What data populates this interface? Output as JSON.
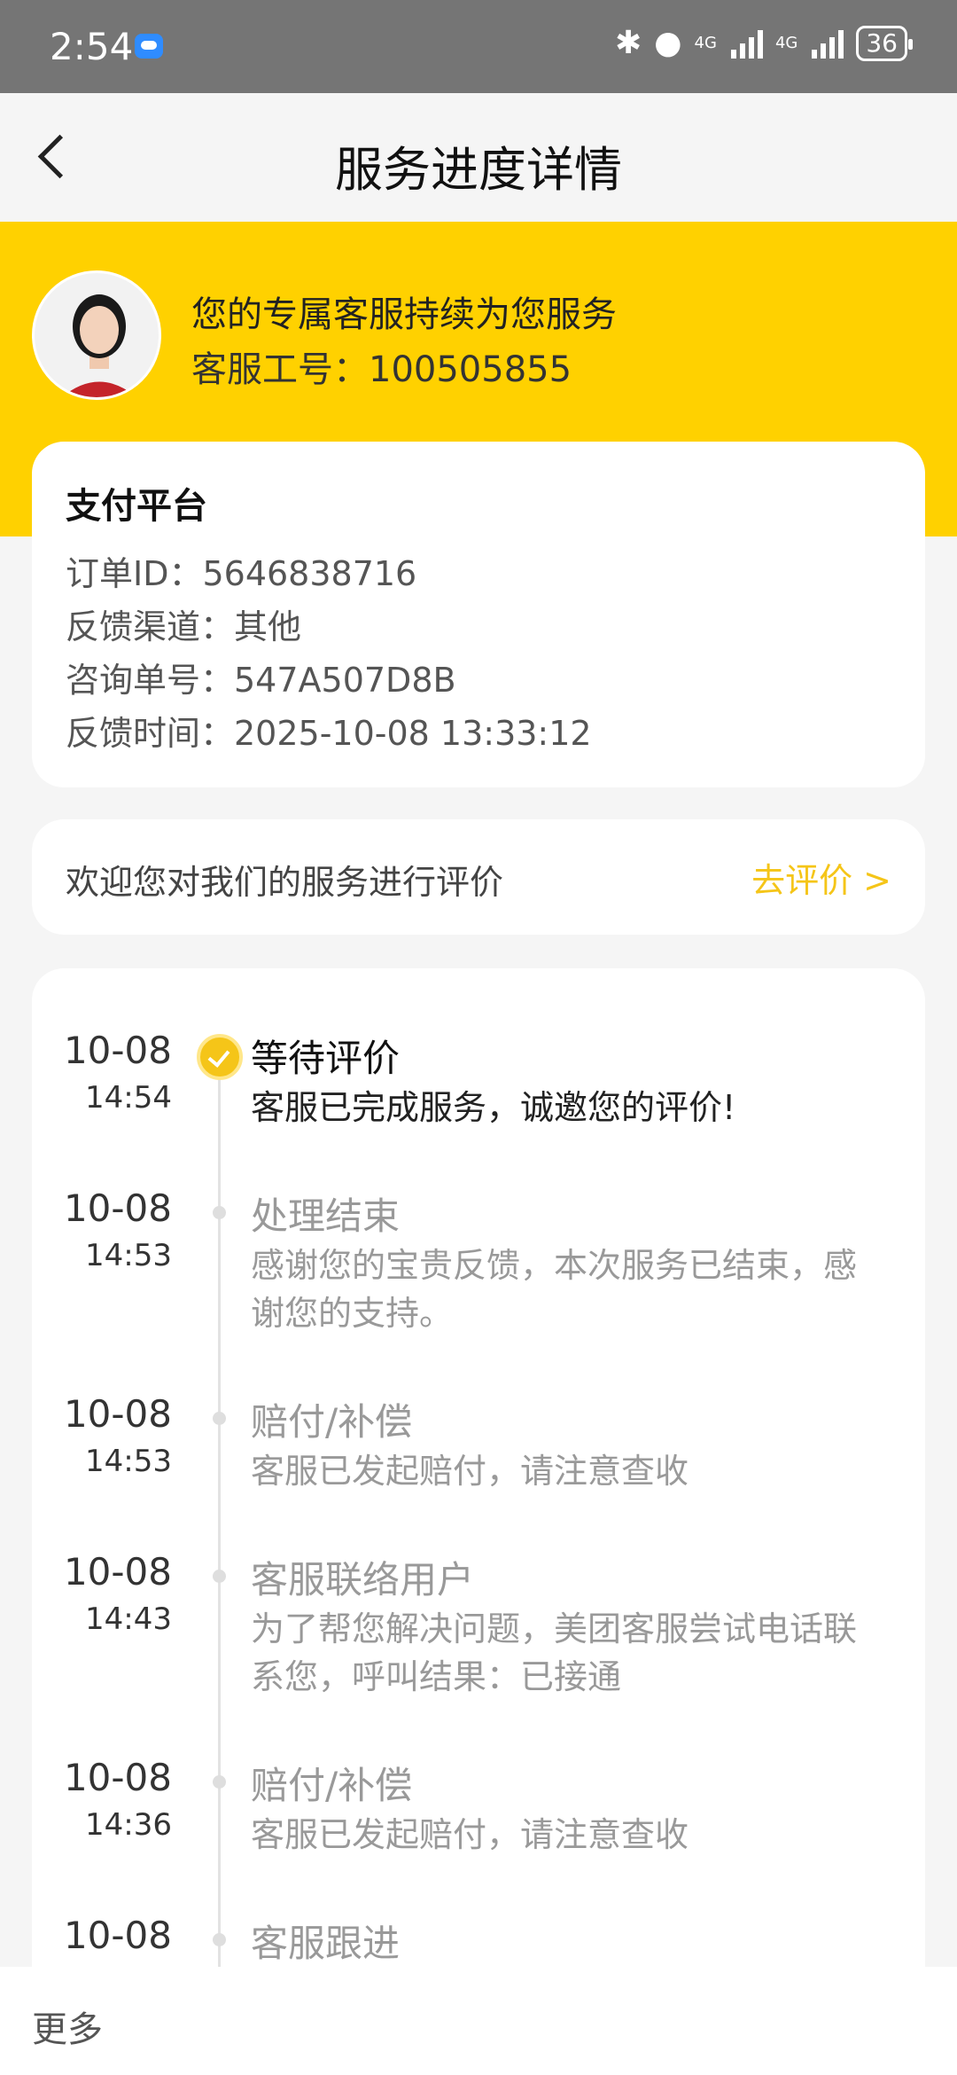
{
  "status_bar": {
    "time": "2:54",
    "network": "4G",
    "battery": "36"
  },
  "nav": {
    "title": "服务进度详情"
  },
  "agent": {
    "line1": "您的专属客服持续为您服务",
    "id_line": "客服工号：100505855"
  },
  "order": {
    "platform": "支付平台",
    "order_id": "订单ID：5646838716",
    "channel": "反馈渠道：其他",
    "ticket": "咨询单号：547A507D8B",
    "time": "反馈时间：2025-10-08 13:33:12"
  },
  "rating": {
    "prompt": "欢迎您对我们的服务进行评价",
    "link": "去评价 >"
  },
  "timeline": [
    {
      "date": "10-08",
      "time": "14:54",
      "status": "等待评价",
      "desc": "客服已完成服务，诚邀您的评价!"
    },
    {
      "date": "10-08",
      "time": "14:53",
      "status": "处理结束",
      "desc": "感谢您的宝贵反馈，本次服务已结束，感谢您的支持。"
    },
    {
      "date": "10-08",
      "time": "14:53",
      "status": "赔付/补偿",
      "desc": "客服已发起赔付，请注意查收"
    },
    {
      "date": "10-08",
      "time": "14:43",
      "status": "客服联络用户",
      "desc": "为了帮您解决问题，美团客服尝试电话联系您，呼叫结果：已接通"
    },
    {
      "date": "10-08",
      "time": "14:36",
      "status": "赔付/补偿",
      "desc": "客服已发起赔付，请注意查收"
    },
    {
      "date": "10-08",
      "time": "",
      "status": "客服跟进",
      "desc": ""
    }
  ],
  "bottom": {
    "more": "更多"
  },
  "colors": {
    "brand_yellow": "#ffd100",
    "accent_link": "#f5c518"
  }
}
